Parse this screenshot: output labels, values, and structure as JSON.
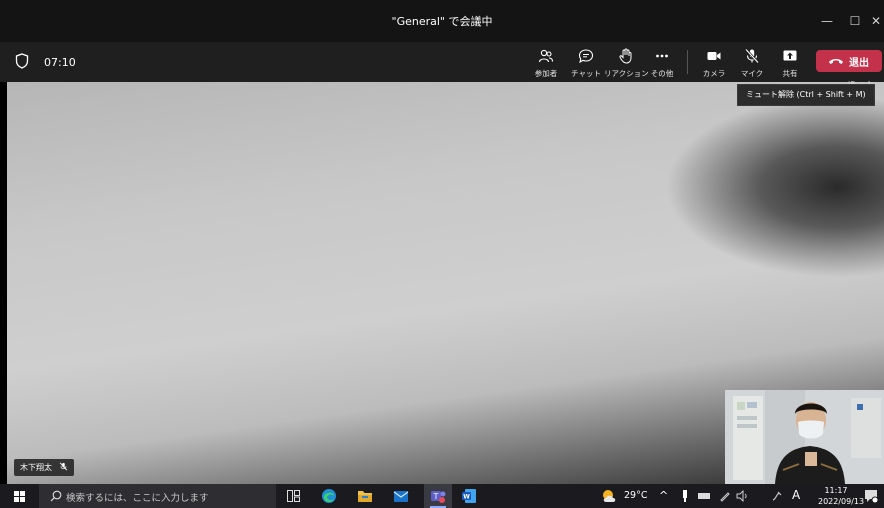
{
  "window": {
    "title": "\"General\" で会議中",
    "minimize_icon": "minimize-icon",
    "maximize_icon": "maximize-icon",
    "close_icon": "close-icon"
  },
  "toolbar": {
    "timer": "07:10",
    "buttons": [
      {
        "label": "参加者",
        "icon": "participants-icon"
      },
      {
        "label": "チャット",
        "icon": "chat-icon"
      },
      {
        "label": "リアクション",
        "icon": "reaction-hand-icon"
      },
      {
        "label": "その他",
        "icon": "more-icon"
      },
      {
        "label": "カメラ",
        "icon": "camera-icon"
      },
      {
        "label": "マイク",
        "icon": "mic-muted-icon"
      },
      {
        "label": "共有",
        "icon": "share-icon"
      }
    ],
    "leave_label": "退出",
    "leave_color": "#c4314b"
  },
  "tooltip": {
    "text": "ミュート解除 (Ctrl + Shift + M)",
    "partial_text": "ift + I"
  },
  "participant": {
    "name": "木下翔太"
  },
  "taskbar": {
    "search_placeholder": "検索するには、ここに入力します",
    "weather": "29°C",
    "ime": "A",
    "time": "11:17",
    "date": "2022/09/13",
    "apps": [
      "task-view-icon",
      "edge-icon",
      "file-explorer-icon",
      "mail-icon",
      "teams-icon",
      "word-icon"
    ]
  }
}
